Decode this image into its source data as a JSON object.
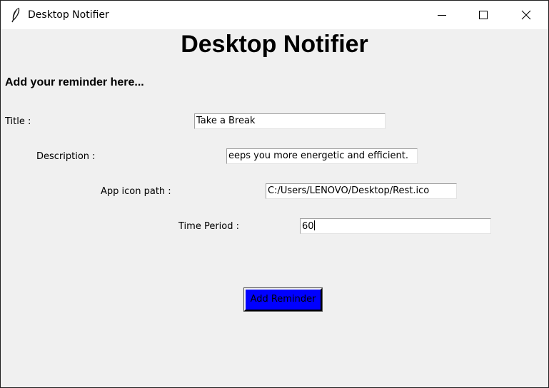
{
  "window": {
    "title": "Desktop Notifier",
    "icon": "feather-icon",
    "controls": [
      "minimize-icon",
      "maximize-icon",
      "close-icon"
    ]
  },
  "main": {
    "heading": "Desktop Notifier",
    "subheading": "Add your reminder here...",
    "fields": {
      "title": {
        "label": "Title :",
        "value": "Take a Break"
      },
      "description": {
        "label": "Description :",
        "value": "eeps you more energetic and efficient."
      },
      "icon_path": {
        "label": "App icon path :",
        "value": "C:/Users/LENOVO/Desktop/Rest.ico"
      },
      "time_period": {
        "label": "Time Period :",
        "value": "60"
      }
    },
    "add_button": {
      "label": "Add Reminder",
      "bg_color": "#0000ff"
    }
  }
}
